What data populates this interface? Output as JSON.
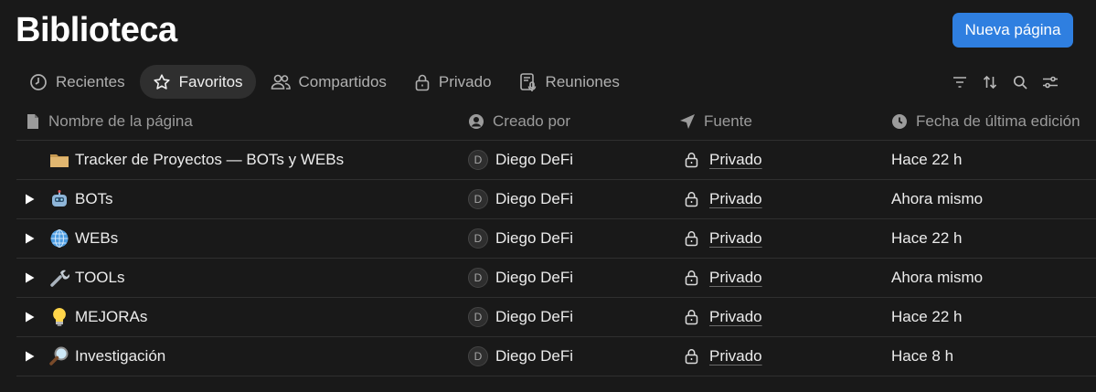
{
  "header": {
    "title": "Biblioteca",
    "new_page_label": "Nueva página"
  },
  "tabs": [
    {
      "label": "Recientes",
      "icon": "clock-icon",
      "active": false
    },
    {
      "label": "Favoritos",
      "icon": "star-icon",
      "active": true
    },
    {
      "label": "Compartidos",
      "icon": "people-icon",
      "active": false
    },
    {
      "label": "Privado",
      "icon": "lock-icon",
      "active": false
    },
    {
      "label": "Reuniones",
      "icon": "meeting-notes-icon",
      "active": false
    }
  ],
  "toolbar": [
    "filter-icon",
    "sort-icon",
    "search-icon",
    "settings-sliders-icon"
  ],
  "table": {
    "columns": [
      {
        "label": "Nombre de la página",
        "icon": "page-icon"
      },
      {
        "label": "Creado por",
        "icon": "user-circle-icon"
      },
      {
        "label": "Fuente",
        "icon": "navigation-arrow-icon"
      },
      {
        "label": "Fecha de última edición",
        "icon": "clock-filled-icon"
      }
    ],
    "rows": [
      {
        "emoji": "🗂️",
        "title": "Tracker de Proyectos — BOTs y WEBs",
        "has_toggle": false,
        "avatar": "D",
        "creator": "Diego DeFi",
        "source": "Privado",
        "edited": "Hace 22 h"
      },
      {
        "emoji": "🤖",
        "title": "BOTs",
        "has_toggle": true,
        "avatar": "D",
        "creator": "Diego DeFi",
        "source": "Privado",
        "edited": "Ahora mismo"
      },
      {
        "emoji": "🌐",
        "title": "WEBs",
        "has_toggle": true,
        "avatar": "D",
        "creator": "Diego DeFi",
        "source": "Privado",
        "edited": "Hace 22 h"
      },
      {
        "emoji": "🔧",
        "title": "TOOLs",
        "has_toggle": true,
        "avatar": "D",
        "creator": "Diego DeFi",
        "source": "Privado",
        "edited": "Ahora mismo"
      },
      {
        "emoji": "💡",
        "title": "MEJORAs",
        "has_toggle": true,
        "avatar": "D",
        "creator": "Diego DeFi",
        "source": "Privado",
        "edited": "Hace 22 h"
      },
      {
        "emoji": "🔎",
        "title": "Investigación",
        "has_toggle": true,
        "avatar": "D",
        "creator": "Diego DeFi",
        "source": "Privado",
        "edited": "Hace 8 h"
      }
    ]
  },
  "colors": {
    "background": "#191919",
    "accent": "#2f7fe0",
    "active_tab": "#2f2f2f",
    "divider": "#2f2f2f"
  }
}
